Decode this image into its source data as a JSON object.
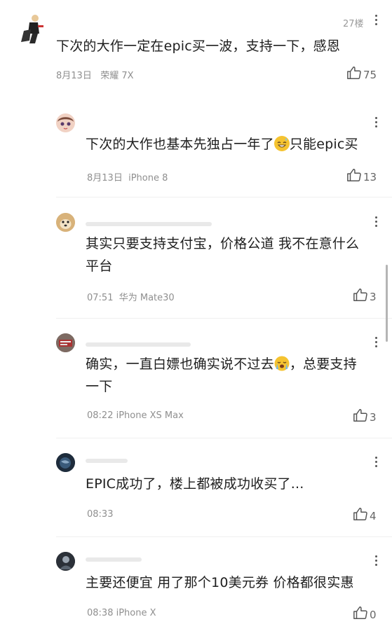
{
  "top_comment": {
    "floor": "27楼",
    "text": "下次的大作一定在epic买一波，支持一下，感恩",
    "date": "8月13日",
    "device": "荣耀 7X",
    "likes": "75"
  },
  "replies": [
    {
      "text_parts": [
        "下次的大作也基本先独占一年了",
        "只能epic买"
      ],
      "emoji": "grinning-sweat-emoji",
      "date": "8月13日",
      "device": "iPhone 8",
      "likes": "13"
    },
    {
      "text_line1": "其实只要支持支付宝，价格公道 我不在意什么",
      "text_line2": "平台",
      "time": "07:51",
      "device": "华为 Mate30",
      "likes": "3"
    },
    {
      "text_part1": "确实，一直白嫖也确实说不过去",
      "text_part2": "，总要支持",
      "text_line2": "一下",
      "emoji": "crying-emoji",
      "time": "08:22",
      "device": "iPhone XS Max",
      "likes": "3"
    },
    {
      "text": "EPIC成功了，楼上都被成功收买了...",
      "time": "08:33",
      "likes": "4"
    },
    {
      "text": "主要还便宜 用了那个10美元券 价格都很实惠",
      "time": "08:38",
      "device": "iPhone X",
      "likes": "0"
    }
  ]
}
